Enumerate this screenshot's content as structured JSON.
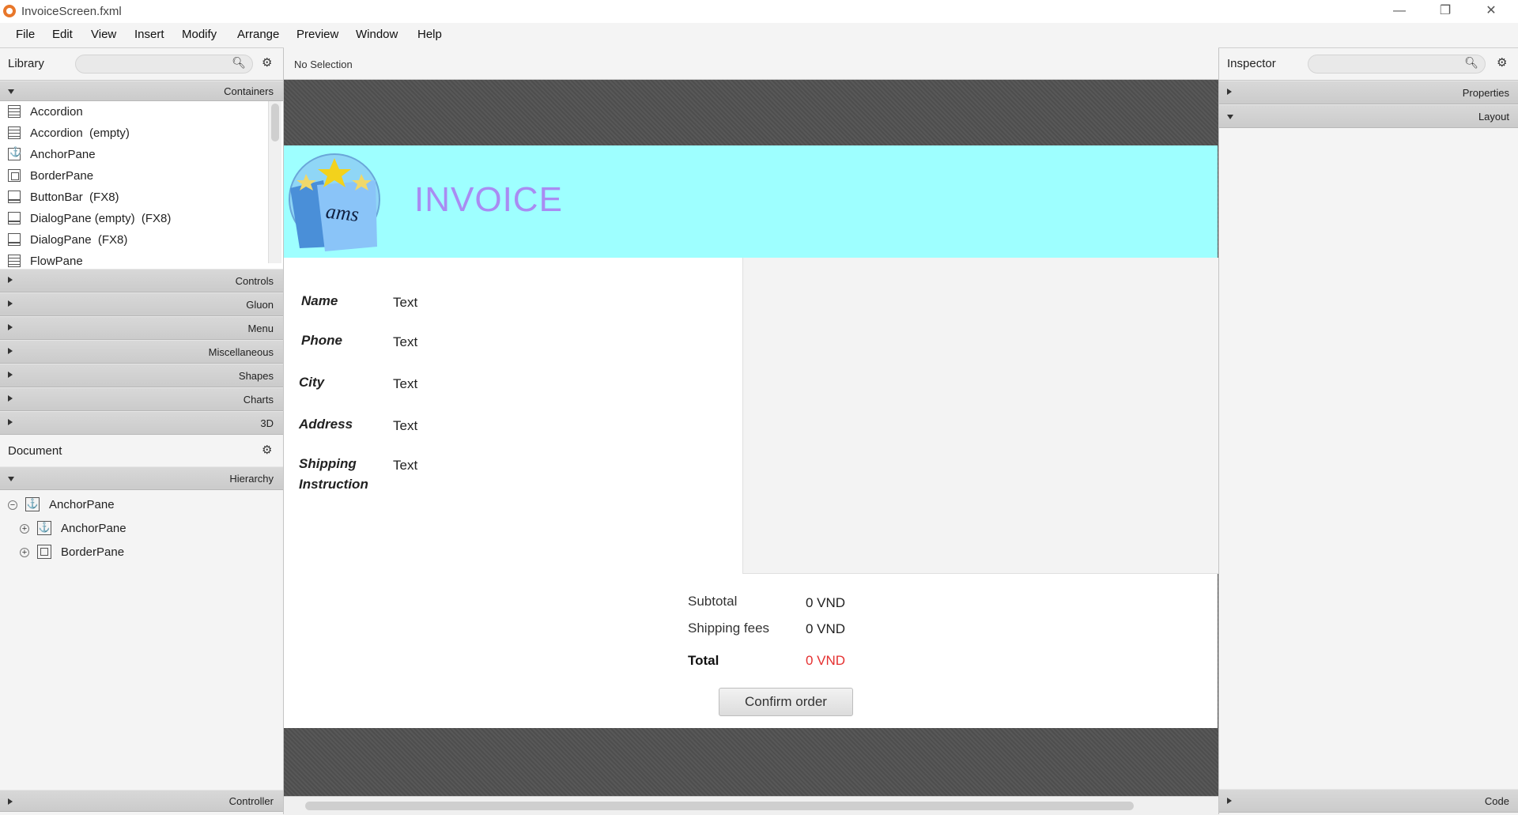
{
  "window": {
    "title": "InvoiceScreen.fxml",
    "controls": {
      "minimize": "—",
      "restore": "❐",
      "close": "✕"
    }
  },
  "menubar": [
    "File",
    "Edit",
    "View",
    "Insert",
    "Modify",
    "Arrange",
    "Preview",
    "Window",
    "Help"
  ],
  "library": {
    "title": "Library",
    "search_placeholder": "",
    "sections": {
      "containers": "Containers",
      "controls": "Controls",
      "gluon": "Gluon",
      "menu": "Menu",
      "misc": "Miscellaneous",
      "shapes": "Shapes",
      "charts": "Charts",
      "threed": "3D"
    },
    "items": [
      {
        "label": "Accordion",
        "icon": "accordion-icon"
      },
      {
        "label": "Accordion  (empty)",
        "icon": "accordion-icon"
      },
      {
        "label": "AnchorPane",
        "icon": "anchorpane-icon"
      },
      {
        "label": "BorderPane",
        "icon": "borderpane-icon"
      },
      {
        "label": "ButtonBar  (FX8)",
        "icon": "buttonbar-icon"
      },
      {
        "label": "DialogPane (empty)  (FX8)",
        "icon": "dialogpane-icon"
      },
      {
        "label": "DialogPane  (FX8)",
        "icon": "dialogpane-icon"
      },
      {
        "label": "FlowPane",
        "icon": "flowpane-icon"
      }
    ]
  },
  "document": {
    "title": "Document",
    "hierarchy_label": "Hierarchy",
    "controller_label": "Controller",
    "tree": [
      {
        "label": "AnchorPane",
        "toggle": "−"
      },
      {
        "label": "AnchorPane",
        "toggle": "+"
      },
      {
        "label": "BorderPane",
        "toggle": "+"
      }
    ]
  },
  "center": {
    "selection_status": "No Selection"
  },
  "inspector": {
    "title": "Inspector",
    "properties_label": "Properties",
    "layout_label": "Layout",
    "code_label": "Code"
  },
  "invoice": {
    "title": "INVOICE",
    "logo_text": "ams",
    "fields": [
      {
        "label": "Name",
        "value": "Text"
      },
      {
        "label": "Phone",
        "value": "Text"
      },
      {
        "label": "City",
        "value": "Text"
      },
      {
        "label": "Address",
        "value": "Text"
      },
      {
        "label": "Shipping Instruction",
        "value": "Text"
      }
    ],
    "summary": {
      "subtotal_label": "Subtotal",
      "subtotal_value": "0 VND",
      "shipping_label": "Shipping fees",
      "shipping_value": "0 VND",
      "total_label": "Total",
      "total_value": "0 VND"
    },
    "confirm_label": "Confirm order",
    "colors": {
      "header_bg": "#9effff",
      "title": "#a98cf2",
      "total_value": "#e53030"
    }
  }
}
